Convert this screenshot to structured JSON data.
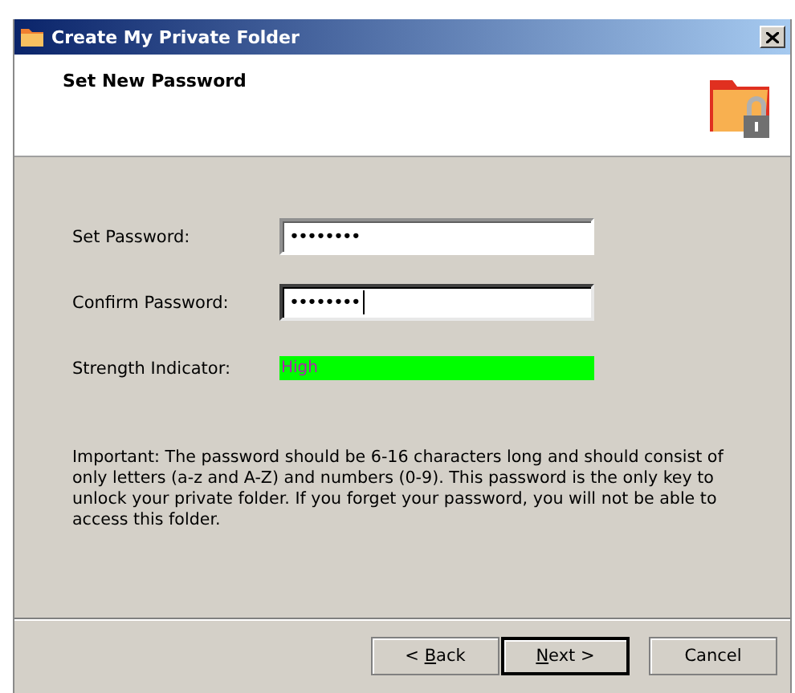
{
  "window": {
    "title": "Create My Private Folder"
  },
  "header": {
    "title": "Set New Password"
  },
  "fields": [
    {
      "label": "Set Password:",
      "value": "••••••••",
      "focused": false
    },
    {
      "label": "Confirm Password:",
      "value": "••••••••",
      "focused": true
    }
  ],
  "strength": {
    "label": "Strength Indicator:",
    "level": 1,
    "reading": "High"
  },
  "note": "Important: The password should be 6-16 characters long and should consist of only letters (a-z and A-Z) and numbers (0-9). This password is the only key to unlock your private folder. If you forget your password, you will not be able to access this folder.",
  "buttons": [
    {
      "before": "< ",
      "key": "B",
      "after": "ack",
      "default": false
    },
    {
      "key": "N",
      "after": "ext >",
      "default": true
    },
    {
      "before": "Cancel",
      "default": false
    }
  ]
}
